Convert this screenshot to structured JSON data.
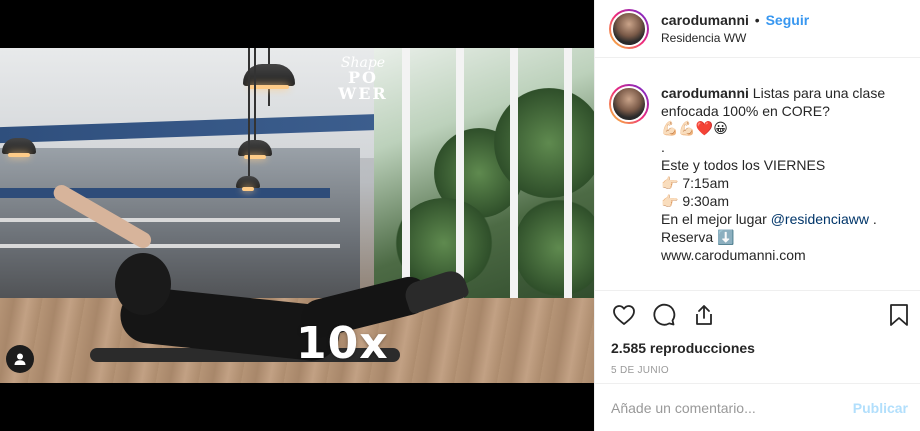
{
  "post": {
    "username": "carodumanni",
    "dot": "•",
    "follow_label": "Seguir",
    "location": "Residencia WW"
  },
  "video": {
    "overlay_reps": "10x",
    "logo_lines": [
      "Shape",
      "PO",
      "WER"
    ]
  },
  "caption": {
    "username": "carodumanni",
    "lines": [
      "Listas para una clase",
      "enfocada 100% en CORE?",
      "💪🏻💪🏻❤️😀",
      ".",
      "Este y todos los VIERNES",
      "👉🏻 7:15am",
      "👉🏻 9:30am",
      "En el mejor lugar",
      "@residenciaww",
      ".",
      "Reserva ⬇️",
      "www.carodumanni.com"
    ]
  },
  "stats": {
    "views": "2.585 reproducciones",
    "date": "5 DE JUNIO"
  },
  "comment": {
    "placeholder": "Añade un comentario...",
    "publish_label": "Publicar"
  },
  "icons": {
    "like": "heart-icon",
    "comment": "comment-icon",
    "share": "share-icon",
    "save": "bookmark-icon",
    "user_tag": "user-icon"
  },
  "colors": {
    "accent": "#3897f0",
    "publish_disabled": "#b2dffc",
    "muted": "#999999"
  }
}
